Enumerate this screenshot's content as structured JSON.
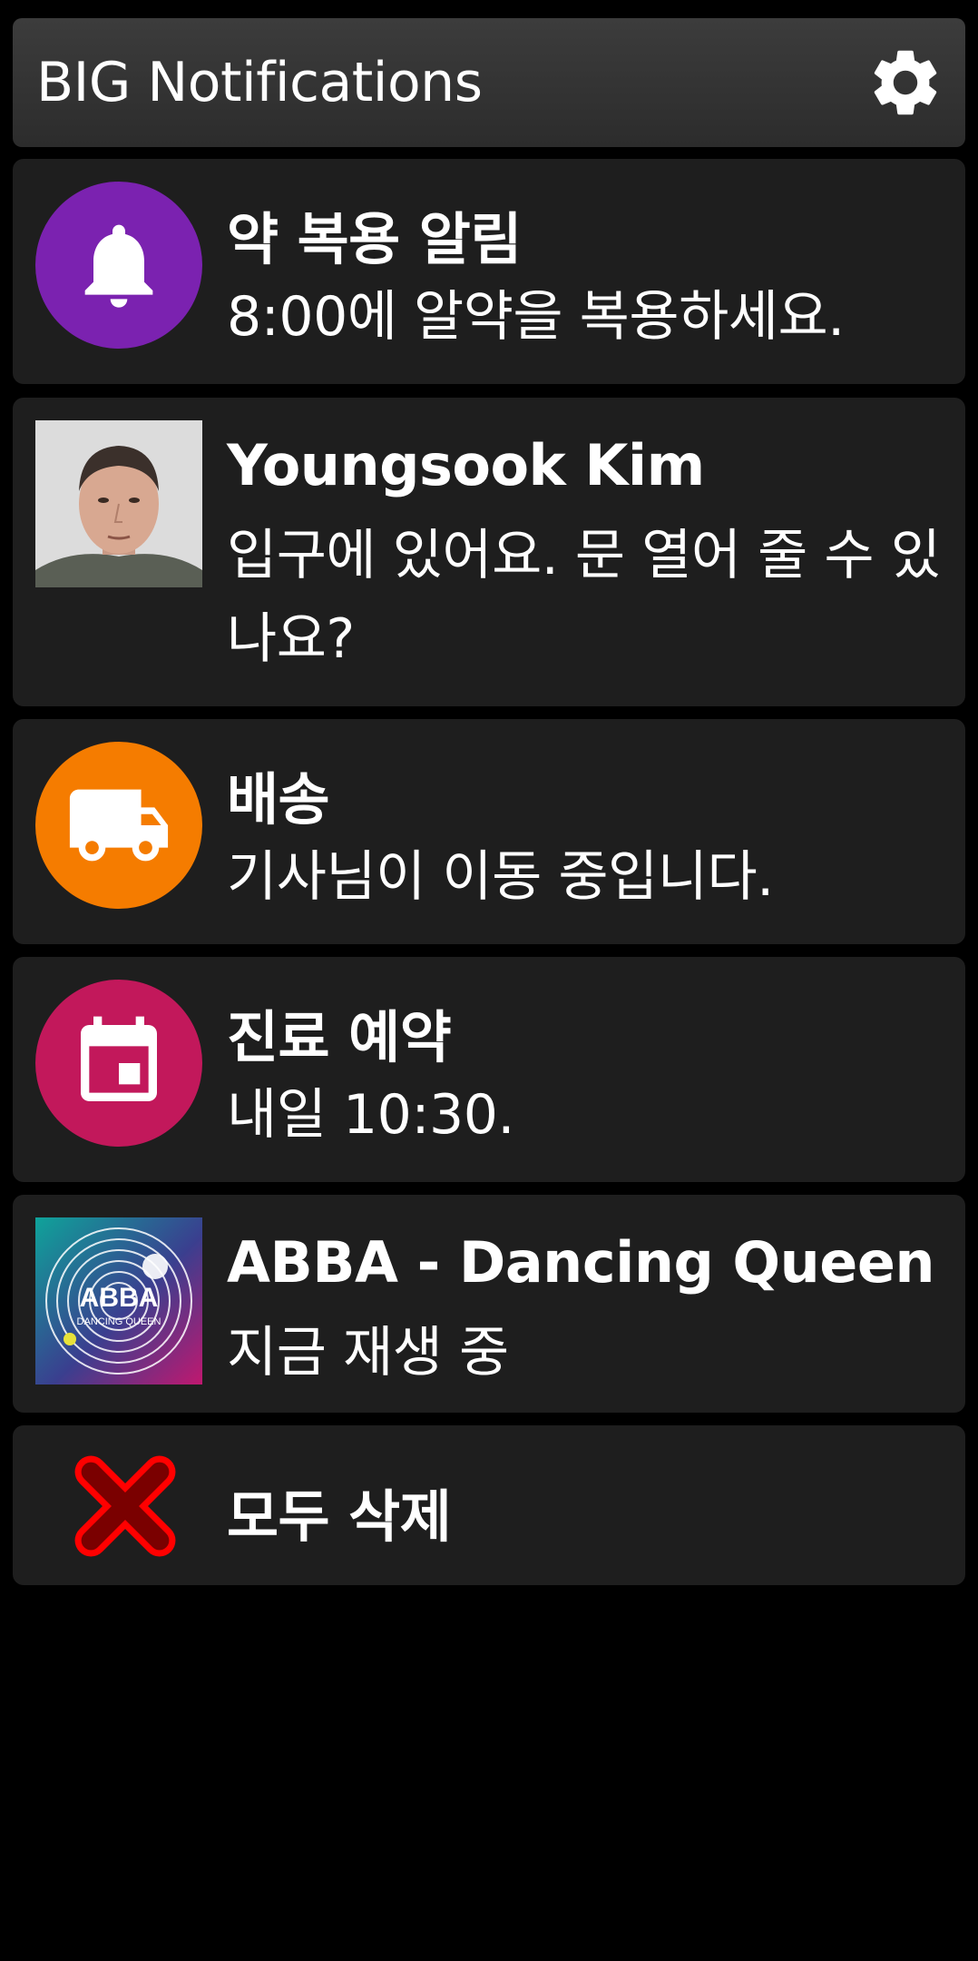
{
  "header": {
    "title": "BIG Notifications",
    "settings_icon": "gear-icon"
  },
  "notifications": [
    {
      "title": "약 복용 알림",
      "body": "8:00에 알약을 복용하세요.",
      "icon": "bell-icon",
      "color": "#7b22b0"
    },
    {
      "title": "Youngsook Kim",
      "body": "입구에 있어요. 문 열어 줄 수 있나요?",
      "icon": "avatar"
    },
    {
      "title": "배송",
      "body": "기사님이 이동 중입니다.",
      "icon": "truck-icon",
      "color": "#f57c00"
    },
    {
      "title": "진료 예약",
      "body": "내일 10:30.",
      "icon": "calendar-icon",
      "color": "#c2185b"
    },
    {
      "title": "ABBA - Dancing Queen",
      "body": "지금 재생 중",
      "icon": "album-art",
      "album_art_text": [
        "ABBA",
        "DANCING QUEEN"
      ]
    }
  ],
  "clear_all": {
    "label": "모두 삭제",
    "icon": "clear-all-icon",
    "color": "#e00000"
  }
}
